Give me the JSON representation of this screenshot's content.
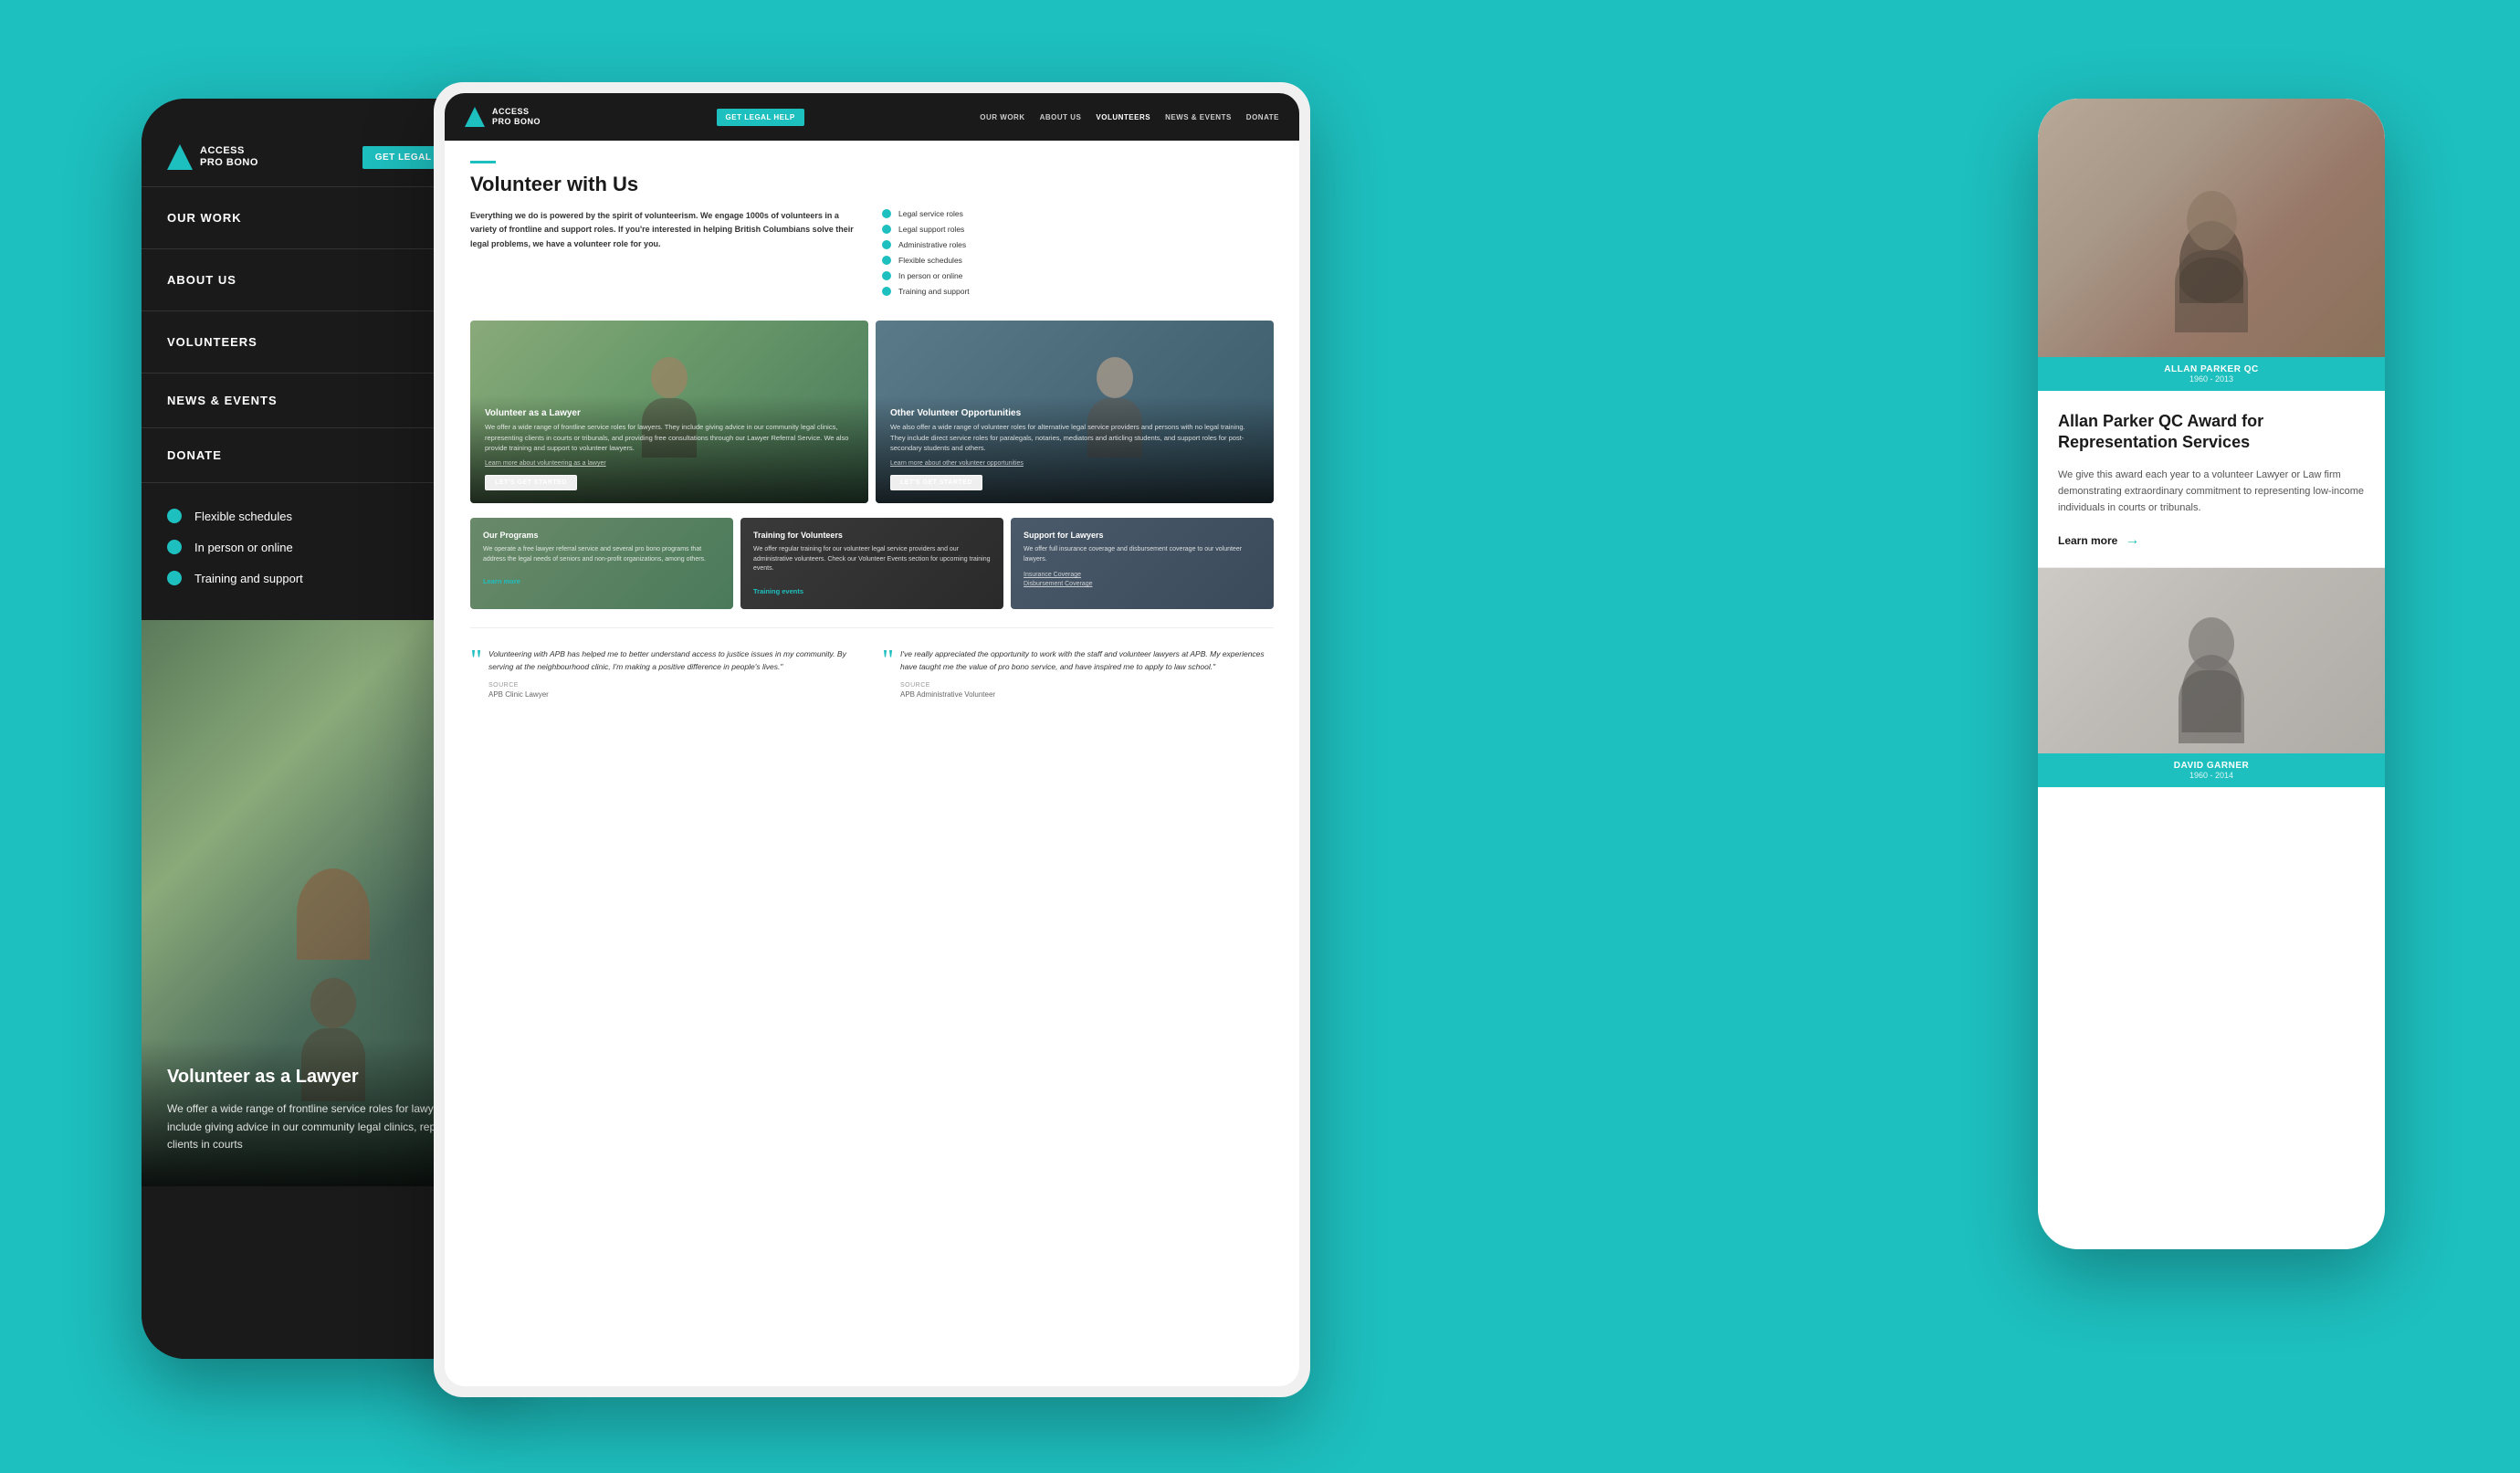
{
  "background": {
    "color": "#1ebfbf"
  },
  "phone_left": {
    "header": {
      "logo_text_line1": "ACCESS",
      "logo_text_line2": "PRO BONO",
      "get_help_label": "GET LEGAL HELP"
    },
    "nav": {
      "items": [
        {
          "label": "OUR WORK"
        },
        {
          "label": "ABOUT US"
        },
        {
          "label": "VOLUNTEERS"
        },
        {
          "label": "NEWS & EVENTS"
        },
        {
          "label": "DONATE"
        }
      ]
    },
    "features": [
      {
        "text": "Flexible schedules"
      },
      {
        "text": "In person or online"
      },
      {
        "text": "Training and support"
      }
    ],
    "card": {
      "title": "Volunteer as a Lawyer",
      "text": "We offer a wide range of frontline service roles for lawyers. They include giving advice in our community legal clinics, representing clients in courts"
    }
  },
  "tablet_center": {
    "nav": {
      "logo_line1": "ACCESS",
      "logo_line2": "PRO BONO",
      "get_help": "GET LEGAL HELP",
      "links": [
        "OUR WORK",
        "ABOUT US",
        "VOLUNTEERS",
        "NEWS & EVENTS",
        "DONATE"
      ]
    },
    "page_title": "Volunteer with Us",
    "intro_text": "Everything we do is powered by the spirit of volunteerism. We engage 1000s of volunteers in a variety of frontline and support roles. If you're interested in helping British Columbians solve their legal problems, we have a volunteer role for you.",
    "features": [
      "Legal service roles",
      "Legal support roles",
      "Administrative roles",
      "Flexible schedules",
      "In person or online",
      "Training and support"
    ],
    "photo_cards": [
      {
        "title": "Volunteer as a Lawyer",
        "desc": "We offer a wide range of frontline service roles for lawyers. They include giving advice in our community legal clinics, representing clients in courts or tribunals, and providing free consultations through our Lawyer Referral Service. We also provide training and support to volunteer lawyers.",
        "link": "Learn more about volunteering as a lawyer",
        "btn": "LET'S GET STARTED"
      },
      {
        "title": "Other Volunteer Opportunities",
        "desc": "We also offer a wide range of volunteer roles for alternative legal service providers and persons with no legal training. They include direct service roles for paralegals, notaries, mediators and articling students, and support roles for post-secondary students and others.",
        "link": "Learn more about other volunteer opportunities",
        "btn": "LET'S GET STARTED"
      }
    ],
    "small_cards": [
      {
        "title": "Our Programs",
        "text": "We operate a free lawyer referral service and several pro bono programs that address the legal needs of seniors and non-profit organizations, among others.",
        "link": "Learn more"
      },
      {
        "title": "Training for Volunteers",
        "text": "We offer regular training for our volunteer legal service providers and our administrative volunteers. Check our Volunteer Events section for upcoming training events.",
        "link1": "Training events"
      },
      {
        "title": "Support for Lawyers",
        "text": "We offer full insurance coverage and disbursement coverage to our volunteer lawyers.",
        "link1": "Insurance Coverage",
        "link2": "Disbursement Coverage"
      }
    ],
    "quotes": [
      {
        "text": "Volunteering with APB has helped me to better understand access to justice issues in my community. By serving at the neighbourhood clinic, I'm making a positive difference in people's lives.\"",
        "source_label": "Source",
        "source": "APB Clinic Lawyer"
      },
      {
        "text": "I've really appreciated the opportunity to work with the staff and volunteer lawyers at APB. My experiences have taught me the value of pro bono service, and have inspired me to apply to law school.\"",
        "source_label": "Source",
        "source": "APB Administrative Volunteer"
      }
    ]
  },
  "phone_right": {
    "card1": {
      "name": "ALLAN PARKER QC",
      "years": "1960 - 2013"
    },
    "award_title": "Allan Parker QC Award for Representation Services",
    "award_text": "We give this award each year to a volunteer Lawyer or Law firm demonstrating extraordinary commitment to representing low-income individuals in courts or tribunals.",
    "learn_more": "Learn more",
    "card2": {
      "name": "DAVID GARNER",
      "years": "1960 - 2014"
    }
  }
}
